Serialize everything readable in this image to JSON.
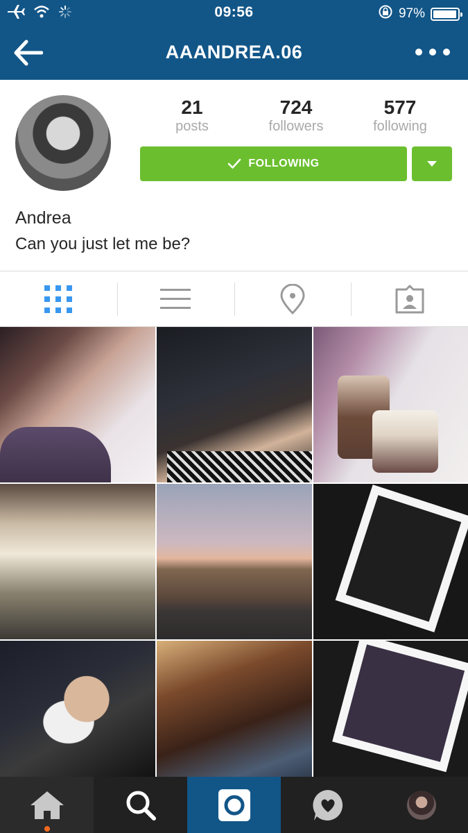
{
  "status_bar": {
    "time": "09:56",
    "battery": "97%",
    "battery_fraction": 0.97
  },
  "nav": {
    "title": "AAANDREA.06"
  },
  "profile": {
    "stats": [
      {
        "value": "21",
        "label": "posts"
      },
      {
        "value": "724",
        "label": "followers"
      },
      {
        "value": "577",
        "label": "following"
      }
    ],
    "follow_label": "FOLLOWING",
    "name": "Andrea",
    "bio": "Can you just let me be?"
  },
  "tabs": [
    {
      "icon": "grid-icon",
      "active": true
    },
    {
      "icon": "list-icon",
      "active": false
    },
    {
      "icon": "location-pin-icon",
      "active": false
    },
    {
      "icon": "tagged-photos-icon",
      "active": false
    }
  ],
  "bottom_nav": [
    {
      "icon": "home-icon",
      "notification_dot": true
    },
    {
      "icon": "search-icon"
    },
    {
      "icon": "camera-icon",
      "active": true
    },
    {
      "icon": "activity-heart-icon"
    },
    {
      "icon": "profile-avatar"
    }
  ],
  "colors": {
    "header_blue": "#125688",
    "follow_green": "#6bbf2e",
    "notification_orange": "#f56a1f",
    "bottom_bar": "#212121"
  }
}
